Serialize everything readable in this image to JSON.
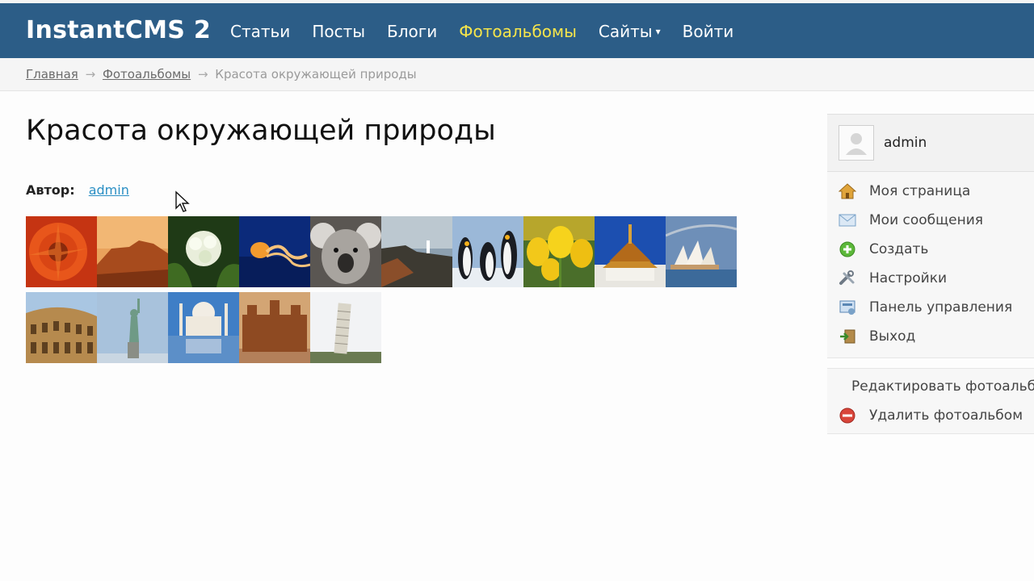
{
  "header": {
    "logo": "InstantCMS 2",
    "nav": [
      {
        "label": "Статьи",
        "active": false
      },
      {
        "label": "Посты",
        "active": false
      },
      {
        "label": "Блоги",
        "active": false
      },
      {
        "label": "Фотоальбомы",
        "active": true
      },
      {
        "label": "Сайты",
        "active": false,
        "has_dropdown": true
      },
      {
        "label": "Войти",
        "active": false
      }
    ]
  },
  "breadcrumb": {
    "items": [
      "Главная",
      "Фотоальбомы"
    ],
    "separator": "→",
    "current": "Красота окружающей природы"
  },
  "album": {
    "title": "Красота окружающей природы",
    "author_label": "Автор:",
    "author_name": "admin",
    "photos": [
      "orange-flower-icon",
      "desert-canyon-icon",
      "white-hydrangea-icon",
      "jellyfish-icon",
      "koala-icon",
      "lighthouse-coast-icon",
      "penguins-icon",
      "yellow-tulips-icon",
      "thai-temple-icon",
      "sydney-opera-icon",
      "colosseum-icon",
      "statue-of-liberty-icon",
      "taj-mahal-icon",
      "mud-mosque-icon",
      "leaning-tower-icon"
    ]
  },
  "sidebar": {
    "username": "admin",
    "menu": [
      {
        "label": "Моя страница",
        "icon": "home-icon"
      },
      {
        "label": "Мои сообщения",
        "icon": "envelope-icon"
      },
      {
        "label": "Создать",
        "icon": "plus-icon"
      },
      {
        "label": "Настройки",
        "icon": "tools-icon"
      },
      {
        "label": "Панель управления",
        "icon": "dashboard-icon"
      },
      {
        "label": "Выход",
        "icon": "exit-icon"
      }
    ],
    "actions": [
      {
        "label": "Редактировать фотоальбом",
        "icon": "pencil-icon"
      },
      {
        "label": "Удалить фотоальбом",
        "icon": "delete-icon"
      }
    ]
  },
  "colors": {
    "header_bg": "#2c5d87",
    "nav_active": "#f6e54b",
    "link": "#2a8fc4"
  }
}
